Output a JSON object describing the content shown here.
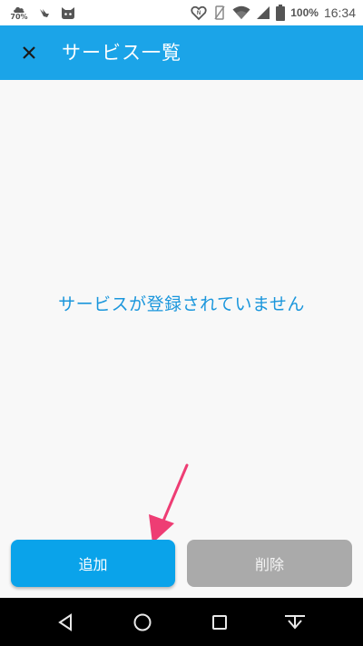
{
  "status_bar": {
    "weather_icon": "weather-cloud-icon",
    "weather_value": "70%",
    "notification_icons": [
      "bird-icon",
      "cat-app-icon"
    ],
    "right_icons": [
      "nfc-icon",
      "vibrate-icon",
      "wifi-icon",
      "signal-icon",
      "battery-icon"
    ],
    "battery": "100%",
    "time": "16:34"
  },
  "app_bar": {
    "close_icon": "close-icon",
    "title": "サービス一覧",
    "color": "#1ba4e8"
  },
  "main": {
    "empty_message": "サービスが登録されていません"
  },
  "actions": {
    "add_label": "追加",
    "delete_label": "削除",
    "add_color": "#0aa3ea",
    "delete_color": "#aaaaaa"
  },
  "annotation": {
    "arrow_color": "#ee3d74"
  },
  "nav_bar": {
    "items": [
      "back-icon",
      "home-icon",
      "recents-icon",
      "notification-pulldown-icon"
    ]
  }
}
